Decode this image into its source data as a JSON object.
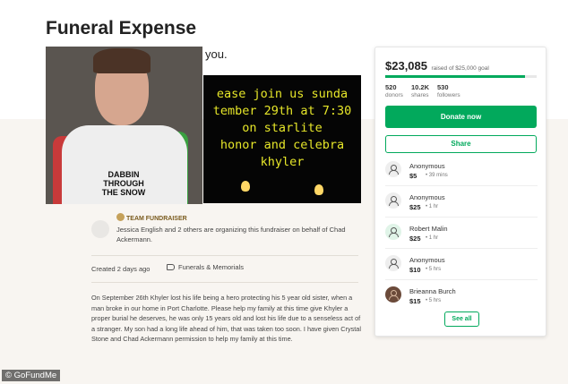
{
  "page": {
    "title": "Funeral Expense"
  },
  "media": {
    "caption_fragment": "you.",
    "shirt_text": "DABBIN THROUGH THE SNOW",
    "flyer_lines": [
      "ease join us sunda",
      "tember 29th at 7:30",
      "on starlite",
      "honor and celebra",
      "khyler"
    ]
  },
  "sidebar": {
    "amount_raised": "$23,085",
    "goal_text": "raised of $25,000 goal",
    "progress_fraction": 0.923,
    "stats": [
      {
        "value": "520",
        "label": "donors"
      },
      {
        "value": "10.2K",
        "label": "shares"
      },
      {
        "value": "530",
        "label": "followers"
      }
    ],
    "donate_label": "Donate now",
    "share_label": "Share",
    "donations": [
      {
        "name": "Anonymous",
        "amount": "$5",
        "time": "39 mins",
        "avatar": "person-icon"
      },
      {
        "name": "Anonymous",
        "amount": "$25",
        "time": "1 hr",
        "avatar": "person-icon"
      },
      {
        "name": "Robert Malin",
        "amount": "$25",
        "time": "1 hr",
        "avatar": "person-icon"
      },
      {
        "name": "Anonymous",
        "amount": "$10",
        "time": "5 hrs",
        "avatar": "person-icon"
      },
      {
        "name": "Brieanna Burch",
        "amount": "$15",
        "time": "5 hrs",
        "avatar": "photo"
      }
    ],
    "see_all_label": "See all"
  },
  "organizer": {
    "tag": "TEAM FUNDRAISER",
    "text": "Jessica English and 2 others are organizing this fundraiser on behalf of Chad Ackermann."
  },
  "meta": {
    "created": "Created 2 days ago",
    "category": "Funerals & Memorials"
  },
  "story": "On September 26th Khyler lost his life being a hero protecting his 5 year old sister, when a man broke in our home in Port Charlotte. Please help my family at this time give Khyler a proper burial he deserves, he was only 15 years old and lost his life due to a senseless act of a stranger. My son had a long life ahead of him, that was taken too soon. I have given Crystal Stone and Chad Ackermann permission to help my family at this time.",
  "watermark": "© GoFundMe",
  "colors": {
    "accent": "#02a95c",
    "team_tag": "#7a5b1e",
    "flyer_text": "#e6e629"
  }
}
